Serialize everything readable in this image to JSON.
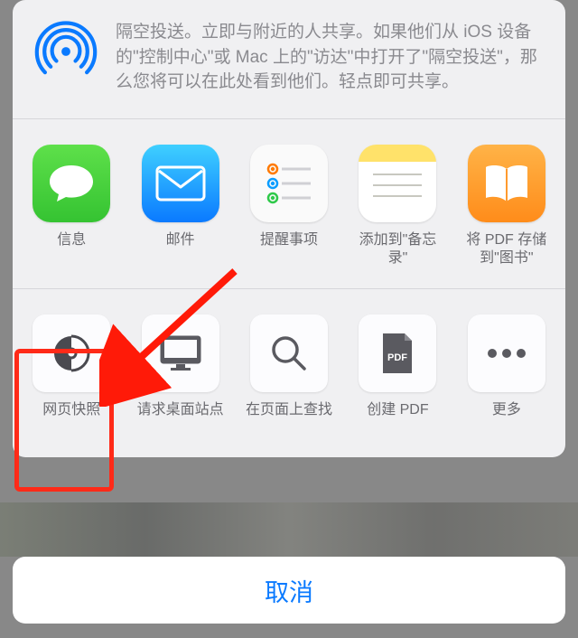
{
  "airdrop": {
    "text": "隔空投送。立即与附近的人共享。如果他们从 iOS 设备的\"控制中心\"或 Mac 上的\"访达\"中打开了\"隔空投送\"，那么您将可以在此处看到他们。轻点即可共享。"
  },
  "apps": [
    {
      "label": "信息"
    },
    {
      "label": "邮件"
    },
    {
      "label": "提醒事项"
    },
    {
      "label": "添加到\"备忘录\""
    },
    {
      "label": "将 PDF 存储到\"图书\""
    }
  ],
  "actions": [
    {
      "label": "网页快照"
    },
    {
      "label": "请求桌面站点"
    },
    {
      "label": "在页面上查找"
    },
    {
      "label": "创建 PDF"
    },
    {
      "label": "更多"
    }
  ],
  "cancel_label": "取消"
}
